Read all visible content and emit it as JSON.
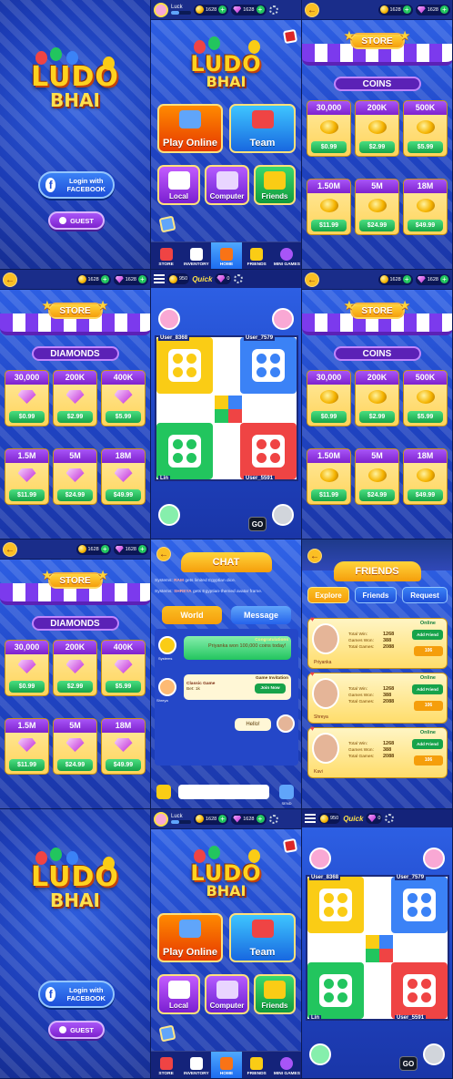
{
  "brand": {
    "line1": "LUDO",
    "line2": "BHAI"
  },
  "login": {
    "facebook_label": "Login with FACEBOOK",
    "guest_label": "GUEST"
  },
  "topbar": {
    "username": "Luck",
    "coins": "1628",
    "diamonds": "1628"
  },
  "home": {
    "tiles": {
      "play_online": "Play Online",
      "team": "Team",
      "local": "Local",
      "computer": "Computer",
      "friends": "Friends"
    },
    "nav": [
      "STORE",
      "INVENTORY",
      "HOME",
      "FRIENDS",
      "MINI GAMES"
    ]
  },
  "store": {
    "sign": "STORE",
    "coins": {
      "heading": "COINS",
      "items": [
        {
          "amount": "30,000",
          "price": "$0.99"
        },
        {
          "amount": "200K",
          "price": "$2.99"
        },
        {
          "amount": "500K",
          "price": "$5.99"
        },
        {
          "amount": "1.50M",
          "price": "$11.99"
        },
        {
          "amount": "5M",
          "price": "$24.99"
        },
        {
          "amount": "18M",
          "price": "$49.99"
        }
      ]
    },
    "diamonds": {
      "heading": "DIAMONDS",
      "items": [
        {
          "amount": "30,000",
          "price": "$0.99"
        },
        {
          "amount": "200K",
          "price": "$2.99"
        },
        {
          "amount": "400K",
          "price": "$5.99"
        },
        {
          "amount": "1.5M",
          "price": "$11.99"
        },
        {
          "amount": "5M",
          "price": "$24.99"
        },
        {
          "amount": "18M",
          "price": "$49.99"
        }
      ]
    }
  },
  "game": {
    "bar": {
      "trophies": "950",
      "quick": "Quick",
      "gems": "0"
    },
    "players": {
      "top_left": "User_8368",
      "top_right": "User_7579",
      "bottom_left": "Lin",
      "bottom_right": "User_5591"
    },
    "go_label": "GO",
    "colors": {
      "yellow": "#facc15",
      "blue": "#3b82f6",
      "green": "#22c55e",
      "red": "#ef4444"
    }
  },
  "chat": {
    "title": "CHAT",
    "system_lines": [
      {
        "prefix": "Systems:",
        "name": "RAM",
        "text": "gets limited Egyptian dice."
      },
      {
        "prefix": "Systems:",
        "name": "SHREYA",
        "text": "gets Egyptian-themed avatar frame."
      }
    ],
    "tabs": {
      "world": "World",
      "message": "Message"
    },
    "messages": {
      "congrats_title": "Congratulations",
      "congrats_text": "Priyanka won 100,000 coins today!",
      "sender1": "Systems",
      "invite_title": "Game Invitation",
      "classic_game": "Classic Game",
      "bet": "Bet: 1k",
      "join_now": "Join Now",
      "sender2": "Shreya",
      "reply": "Hello!"
    },
    "send_label": "SEND"
  },
  "friends": {
    "title": "FRIENDS",
    "tabs": [
      "Explore",
      "Friends",
      "Request"
    ],
    "stat_labels": [
      "Total Win:",
      "Games Won:",
      "Total Games:"
    ],
    "online_label": "Online",
    "add_label": "Add Friend",
    "people": [
      {
        "name": "Priyanka",
        "total_win": "1268",
        "games_won": "388",
        "total_games": "2088",
        "count": "106"
      },
      {
        "name": "Shreya",
        "total_win": "1268",
        "games_won": "388",
        "total_games": "2088",
        "count": "106"
      },
      {
        "name": "Kavi",
        "total_win": "1268",
        "games_won": "388",
        "total_games": "2088",
        "count": "106"
      }
    ]
  }
}
